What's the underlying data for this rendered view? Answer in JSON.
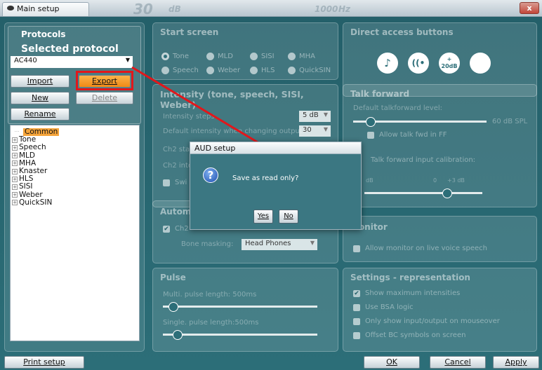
{
  "window": {
    "title": "Main setup",
    "ghost_text": [
      "30",
      "dB",
      "1000",
      "Hz"
    ],
    "close_label": "x"
  },
  "protocols": {
    "heading": "Protocols",
    "selected_label": "Selected protocol",
    "selected_value": "AC440",
    "import_label": "Import",
    "export_label": "Export",
    "new_label": "New",
    "delete_label": "Delete",
    "rename_label": "Rename",
    "tree_items": [
      "Common",
      "Tone",
      "Speech",
      "MLD",
      "MHA",
      "Knaster",
      "HLS",
      "SISI",
      "Weber",
      "QuickSIN"
    ]
  },
  "start_screen": {
    "heading": "Start screen",
    "options": [
      "Tone",
      "MLD",
      "SISI",
      "MHA",
      "Speech",
      "Weber",
      "HLS",
      "QuickSIN"
    ]
  },
  "intensity": {
    "heading": "Intensity (tone, speech, SISI, Weber)",
    "steps_label": "Intensity steps",
    "steps_value": "5 dB",
    "default_label": "Default intensity when changing output:",
    "default_value": "30",
    "ch2_label_1": "Ch2 sta",
    "ch2_label_2": "Ch2 inte",
    "switch_label": "Swi"
  },
  "auto": {
    "heading": "Autom",
    "ch2_label": "Ch2",
    "bone_label": "Bone masking:",
    "bone_value": "Head Phones"
  },
  "pulse": {
    "heading": "Pulse",
    "multi_label": "Multi. pulse length:",
    "multi_value": "500ms",
    "single_label": "Single. pulse length:",
    "single_value": "500ms"
  },
  "direct_access": {
    "heading": "Direct access buttons",
    "icons": [
      "music-note-icon",
      "ear-speaker-icon",
      "plus-20db-icon",
      "blank-circle-icon"
    ],
    "plus_label": "20dB"
  },
  "talk_forward": {
    "heading": "Talk forward",
    "default_label": "Default talkforward level:",
    "level_value": "60 dB SPL",
    "allow_ff_label": "Allow talk fwd in FF",
    "calibration_label": "Talk forward input calibration:",
    "cal_left": "dB",
    "cal_mid": "0",
    "cal_right": "+3 dB",
    "level_fraction": 0.1,
    "cal_fraction": 0.72
  },
  "monitor": {
    "heading": "Monitor",
    "checkbox_label": "Allow monitor on live voice speech"
  },
  "settings_rep": {
    "heading": "Settings - representation",
    "items": [
      {
        "label": "Show maximum intensities",
        "checked": true
      },
      {
        "label": "Use BSA logic",
        "checked": false
      },
      {
        "label": "Only show input/output on mouseover",
        "checked": false
      },
      {
        "label": "Offset BC symbols on screen",
        "checked": false
      }
    ]
  },
  "dialog": {
    "title": "AUD setup",
    "message": "Save as read only?",
    "yes_label": "Yes",
    "no_label": "No"
  },
  "footer": {
    "print_label": "Print setup",
    "ok_label": "OK",
    "cancel_label": "Cancel",
    "apply_label": "Apply"
  },
  "colors": {
    "accent": "#f5a43a",
    "highlight": "#e2171b",
    "background": "#2c6e78"
  }
}
